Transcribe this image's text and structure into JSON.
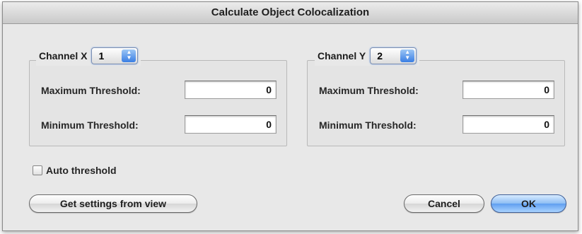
{
  "window": {
    "title": "Calculate Object Colocalization"
  },
  "channel_x": {
    "label": "Channel X",
    "selected": "1",
    "max_label": "Maximum Threshold:",
    "max_value": "0",
    "min_label": "Minimum Threshold:",
    "min_value": "0"
  },
  "channel_y": {
    "label": "Channel Y",
    "selected": "2",
    "max_label": "Maximum Threshold:",
    "max_value": "0",
    "min_label": "Minimum Threshold:",
    "min_value": "0"
  },
  "auto_threshold": {
    "label": "Auto threshold",
    "checked": false
  },
  "buttons": {
    "get_settings": "Get settings from view",
    "cancel": "Cancel",
    "ok": "OK"
  },
  "colors": {
    "default_button": "#5f9ef0",
    "accent": "#3a7ee4"
  }
}
